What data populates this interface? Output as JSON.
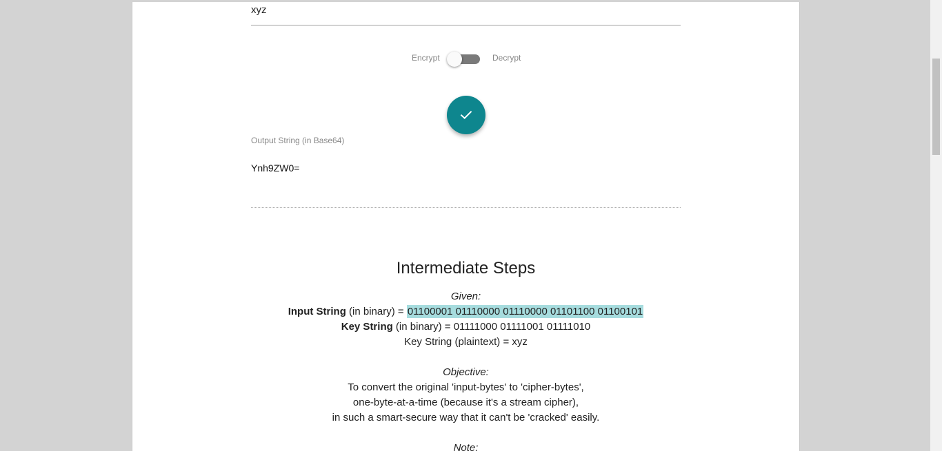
{
  "key_input": {
    "value": "xyz"
  },
  "toggle": {
    "encrypt_label": "Encrypt",
    "decrypt_label": "Decrypt",
    "mode": "encrypt"
  },
  "output": {
    "label": "Output String (in Base64)",
    "value": "Ynh9ZW0="
  },
  "steps": {
    "title": "Intermediate Steps",
    "given_label": "Given:",
    "input_string_label": "Input String",
    "input_binary_text": " (in binary) = ",
    "input_binary_value": "01100001 01110000 01110000 01101100 01100101",
    "key_string_label": "Key String",
    "key_binary_text": " (in binary) = 01111000 01111001 01111010",
    "key_plaintext": "Key String (plaintext) = xyz",
    "objective_label": "Objective:",
    "objective_line1": "To convert the original 'input-bytes' to 'cipher-bytes',",
    "objective_line2": "one-byte-at-a-time (because it's a stream cipher),",
    "objective_line3": "in such a smart-secure way that it can't be 'cracked' easily.",
    "note_label": "Note:"
  },
  "icons": {
    "submit": "check-icon"
  },
  "colors": {
    "accent": "#0e868e",
    "highlight": "#a6dcde",
    "background": "#d3d3d3"
  }
}
